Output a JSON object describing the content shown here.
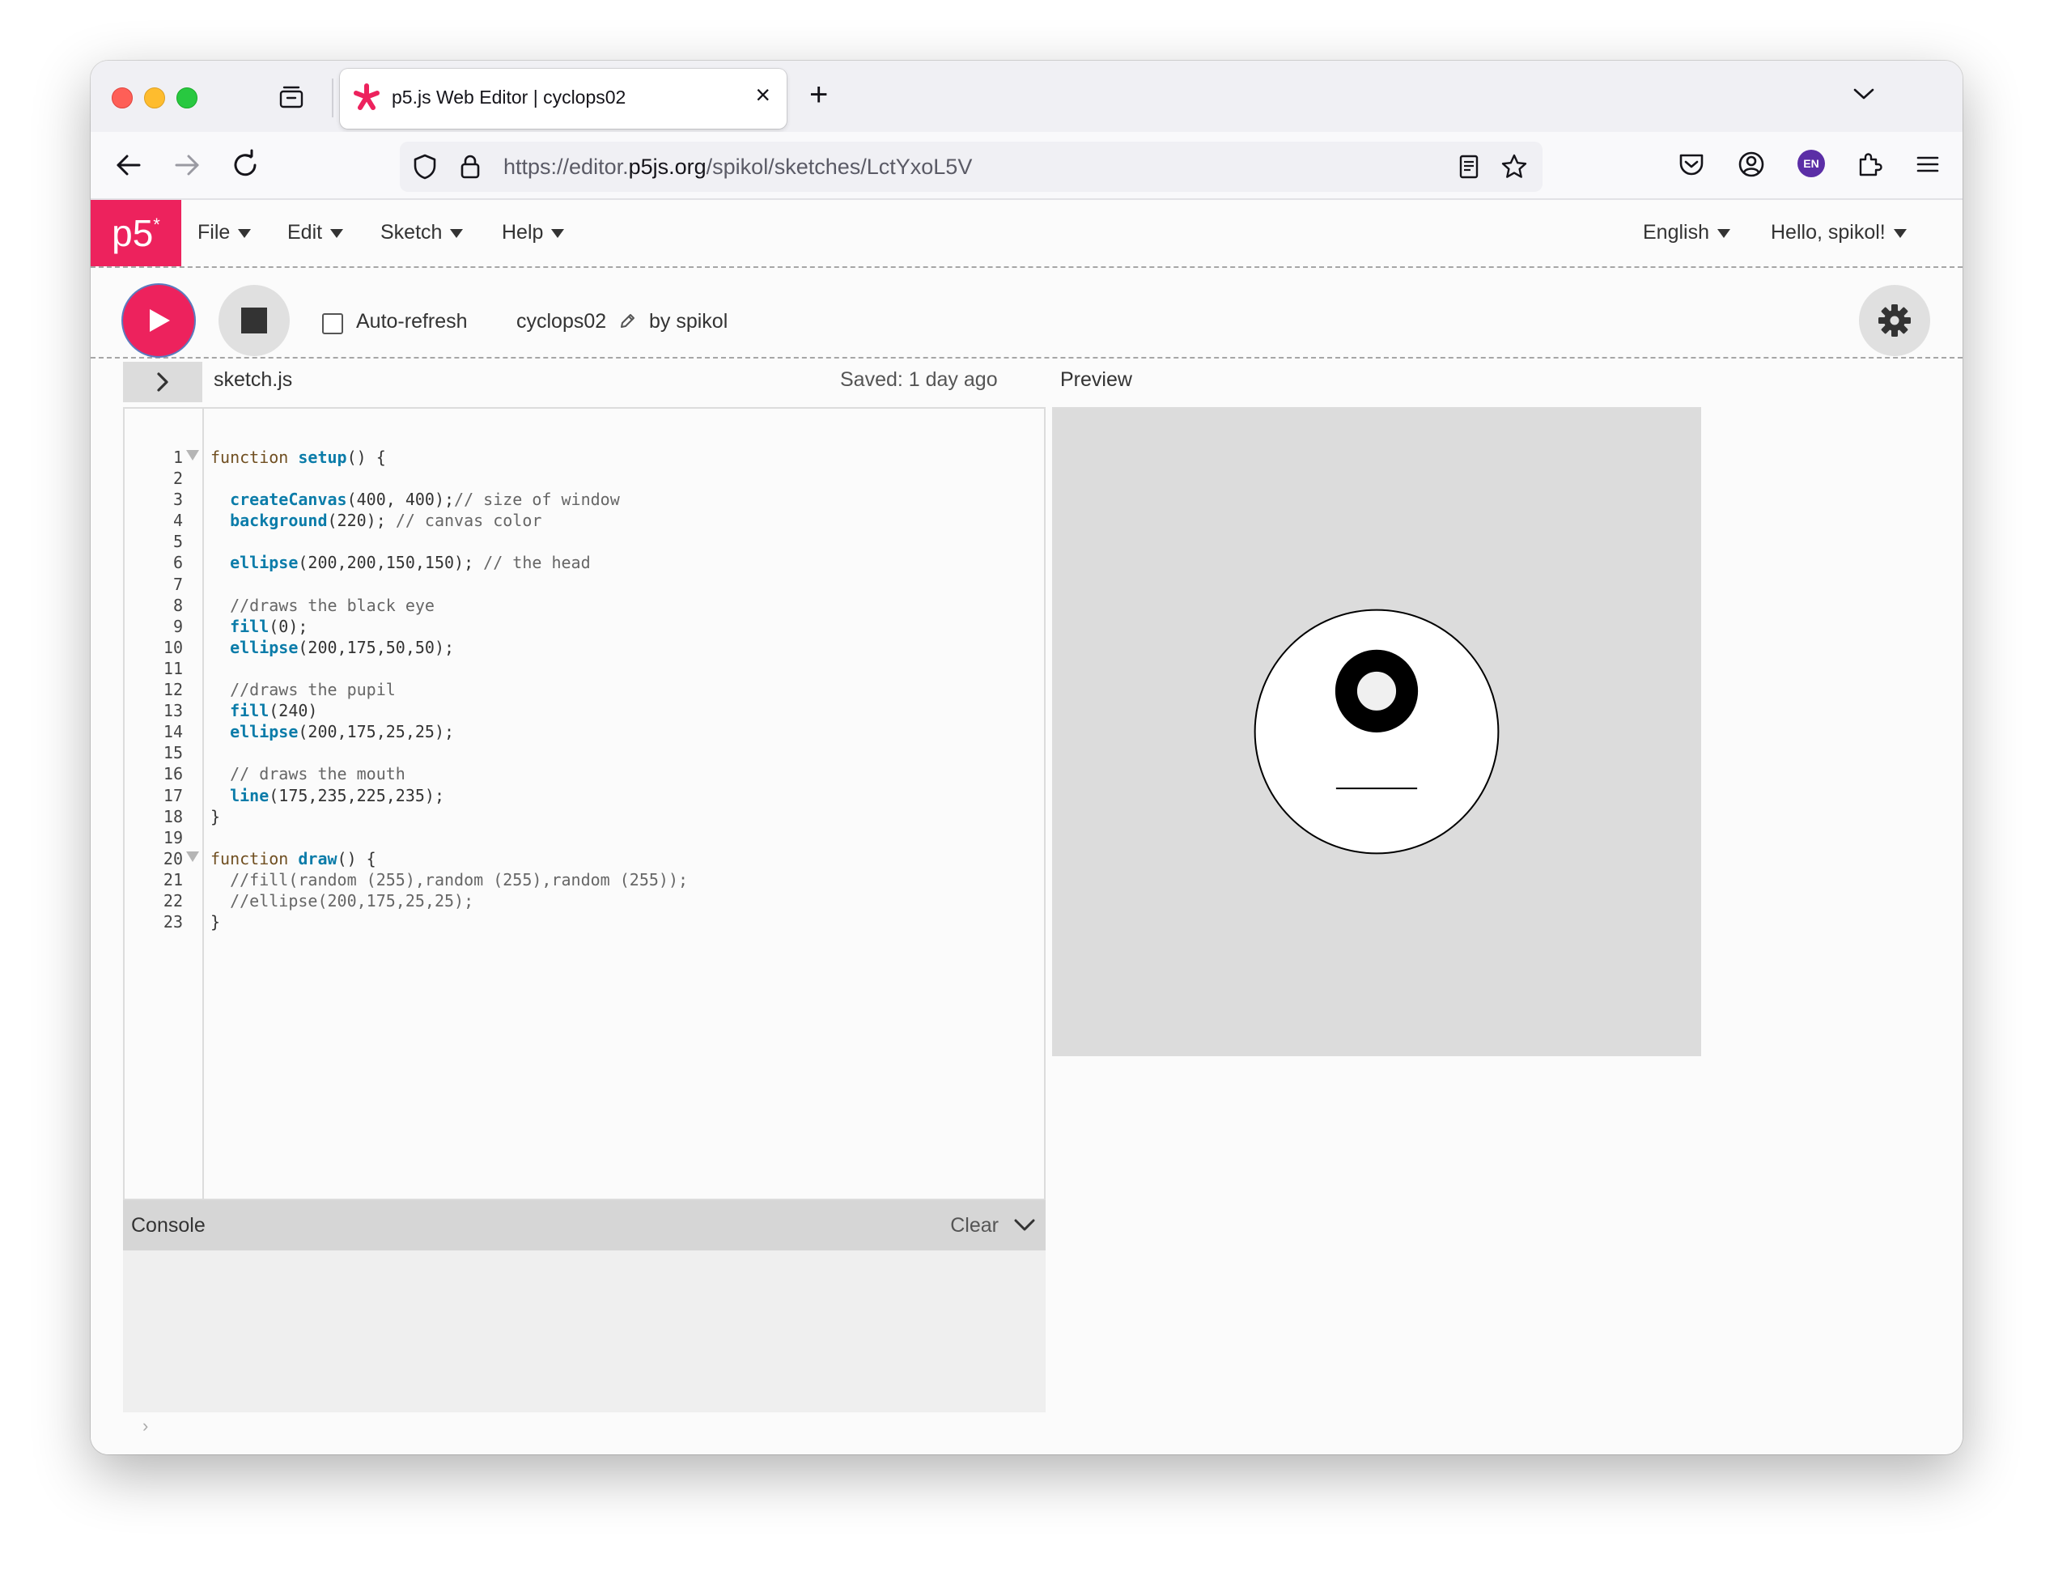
{
  "browser": {
    "tab_title": "p5.js Web Editor | cyclops02",
    "url_prefix": "https://editor.",
    "url_host": "p5js.org",
    "url_path": "/spikol/sketches/LctYxoL5V",
    "profile_badge": "EN"
  },
  "p5": {
    "logo": "p5",
    "logo_mark": "*",
    "menu": {
      "file": "File",
      "edit": "Edit",
      "sketch": "Sketch",
      "help": "Help",
      "language": "English",
      "user": "Hello, spikol!"
    },
    "toolbar": {
      "auto_refresh": "Auto-refresh",
      "auto_refresh_checked": false,
      "sketch_name": "cyclops02",
      "by_user": "by spikol"
    },
    "file": {
      "name": "sketch.js",
      "saved": "Saved: 1 day ago"
    },
    "preview_label": "Preview",
    "console": {
      "title": "Console",
      "clear": "Clear",
      "prompt": "›"
    },
    "code_lines": [
      {
        "n": "1",
        "fold": true,
        "parts": [
          [
            "kw",
            "function "
          ],
          [
            "fn",
            "setup"
          ],
          [
            "p",
            "() {"
          ]
        ]
      },
      {
        "n": "2",
        "parts": []
      },
      {
        "n": "3",
        "parts": [
          [
            "p",
            "  "
          ],
          [
            "fn",
            "createCanvas"
          ],
          [
            "p",
            "(400, 400);"
          ],
          [
            "cm",
            "// size of window"
          ]
        ]
      },
      {
        "n": "4",
        "parts": [
          [
            "p",
            "  "
          ],
          [
            "fn",
            "background"
          ],
          [
            "p",
            "(220); "
          ],
          [
            "cm",
            "// canvas color"
          ]
        ]
      },
      {
        "n": "5",
        "parts": []
      },
      {
        "n": "6",
        "parts": [
          [
            "p",
            "  "
          ],
          [
            "fn",
            "ellipse"
          ],
          [
            "p",
            "(200,200,150,150); "
          ],
          [
            "cm",
            "// the head"
          ]
        ]
      },
      {
        "n": "7",
        "parts": []
      },
      {
        "n": "8",
        "parts": [
          [
            "p",
            "  "
          ],
          [
            "cm",
            "//draws the black eye"
          ]
        ]
      },
      {
        "n": "9",
        "parts": [
          [
            "p",
            "  "
          ],
          [
            "fn",
            "fill"
          ],
          [
            "p",
            "(0);"
          ]
        ]
      },
      {
        "n": "10",
        "parts": [
          [
            "p",
            "  "
          ],
          [
            "fn",
            "ellipse"
          ],
          [
            "p",
            "(200,175,50,50);"
          ]
        ]
      },
      {
        "n": "11",
        "parts": []
      },
      {
        "n": "12",
        "parts": [
          [
            "p",
            "  "
          ],
          [
            "cm",
            "//draws the pupil"
          ]
        ]
      },
      {
        "n": "13",
        "parts": [
          [
            "p",
            "  "
          ],
          [
            "fn",
            "fill"
          ],
          [
            "p",
            "(240)"
          ]
        ]
      },
      {
        "n": "14",
        "parts": [
          [
            "p",
            "  "
          ],
          [
            "fn",
            "ellipse"
          ],
          [
            "p",
            "(200,175,25,25);"
          ]
        ]
      },
      {
        "n": "15",
        "parts": []
      },
      {
        "n": "16",
        "parts": [
          [
            "p",
            "  "
          ],
          [
            "cm",
            "// draws the mouth"
          ]
        ]
      },
      {
        "n": "17",
        "parts": [
          [
            "p",
            "  "
          ],
          [
            "fn",
            "line"
          ],
          [
            "p",
            "(175,235,225,235);"
          ]
        ]
      },
      {
        "n": "18",
        "parts": [
          [
            "p",
            "}"
          ]
        ]
      },
      {
        "n": "19",
        "parts": []
      },
      {
        "n": "20",
        "fold": true,
        "parts": [
          [
            "kw",
            "function "
          ],
          [
            "fn",
            "draw"
          ],
          [
            "p",
            "() {"
          ]
        ]
      },
      {
        "n": "21",
        "parts": [
          [
            "p",
            "  "
          ],
          [
            "cm",
            "//fill(random (255),random (255),random (255));"
          ]
        ]
      },
      {
        "n": "22",
        "parts": [
          [
            "p",
            "  "
          ],
          [
            "cm",
            "//ellipse(200,175,25,25);"
          ]
        ]
      },
      {
        "n": "23",
        "parts": [
          [
            "p",
            "}"
          ]
        ]
      }
    ]
  },
  "colors": {
    "accent": "#ed225d",
    "code_keyword": "#704f21",
    "code_function": "#0b7ca9",
    "code_comment": "#666666"
  }
}
